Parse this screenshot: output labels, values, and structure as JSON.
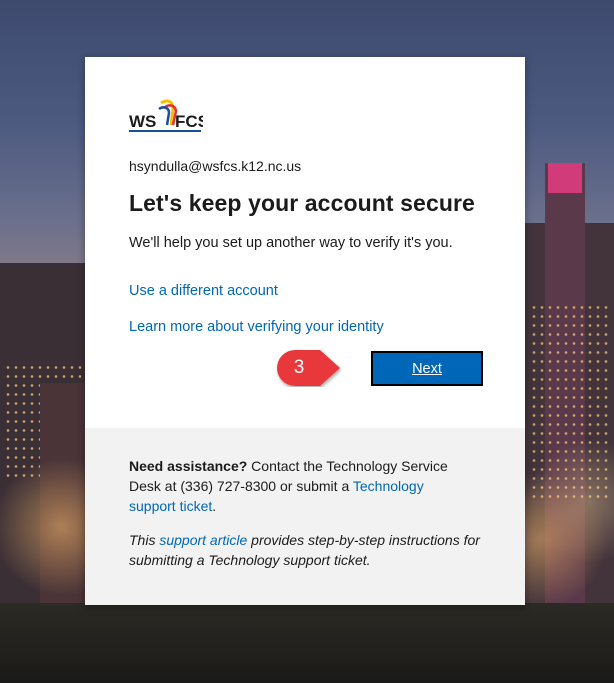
{
  "brand": {
    "logo_text_left": "WS",
    "logo_text_right": "FCS"
  },
  "account": {
    "email": "hsyndulla@wsfcs.k12.nc.us"
  },
  "main": {
    "title": "Let's keep your account secure",
    "description": "We'll help you set up another way to verify it's you.",
    "link_different_account": "Use a different account",
    "link_learn_more": "Learn more about verifying your identity",
    "next_label": "Next"
  },
  "annotation": {
    "step_number": "3",
    "color": "#e8393a"
  },
  "help": {
    "assist_bold": "Need assistance?",
    "assist_text": " Contact the Technology Service Desk at (336) 727-8300 or submit a ",
    "assist_link": "Technology support ticket",
    "assist_end": ".",
    "note_prefix": "This ",
    "note_link": "support article",
    "note_suffix": " provides step-by-step instructions for submitting a Technology support ticket."
  },
  "colors": {
    "link": "#0067b8",
    "button": "#0067b8",
    "footer_bg": "#f2f2f2"
  }
}
